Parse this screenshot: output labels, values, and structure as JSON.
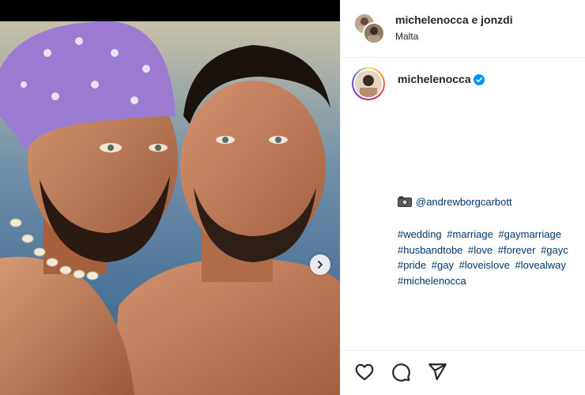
{
  "post": {
    "header": {
      "names": "michelenocca e jonzdi",
      "location": "Malta"
    },
    "author": {
      "username": "michelenocca",
      "verified": true
    },
    "caption": {
      "photo_credit": "@andrewborgcarbott",
      "hashtag_lines": [
        [
          "#wedding",
          "#marriage",
          "#gaymarriage"
        ],
        [
          "#husbandtobe",
          "#love",
          "#forever",
          "#gayc"
        ],
        [
          "#pride",
          "#gay",
          "#loveislove",
          "#lovealway"
        ],
        [
          "#michelenocca"
        ]
      ]
    },
    "icons": {
      "next": "chevron-right-icon",
      "camera": "camera-icon",
      "verified": "verified-badge-icon",
      "like": "heart-icon",
      "comment": "comment-icon",
      "share": "share-icon"
    }
  },
  "colors": {
    "link": "#00376b",
    "verified": "#0095f6",
    "text": "#262626",
    "divider": "#efefef",
    "bandana": "#9b7ad1",
    "sea": "#3f6e9a"
  }
}
